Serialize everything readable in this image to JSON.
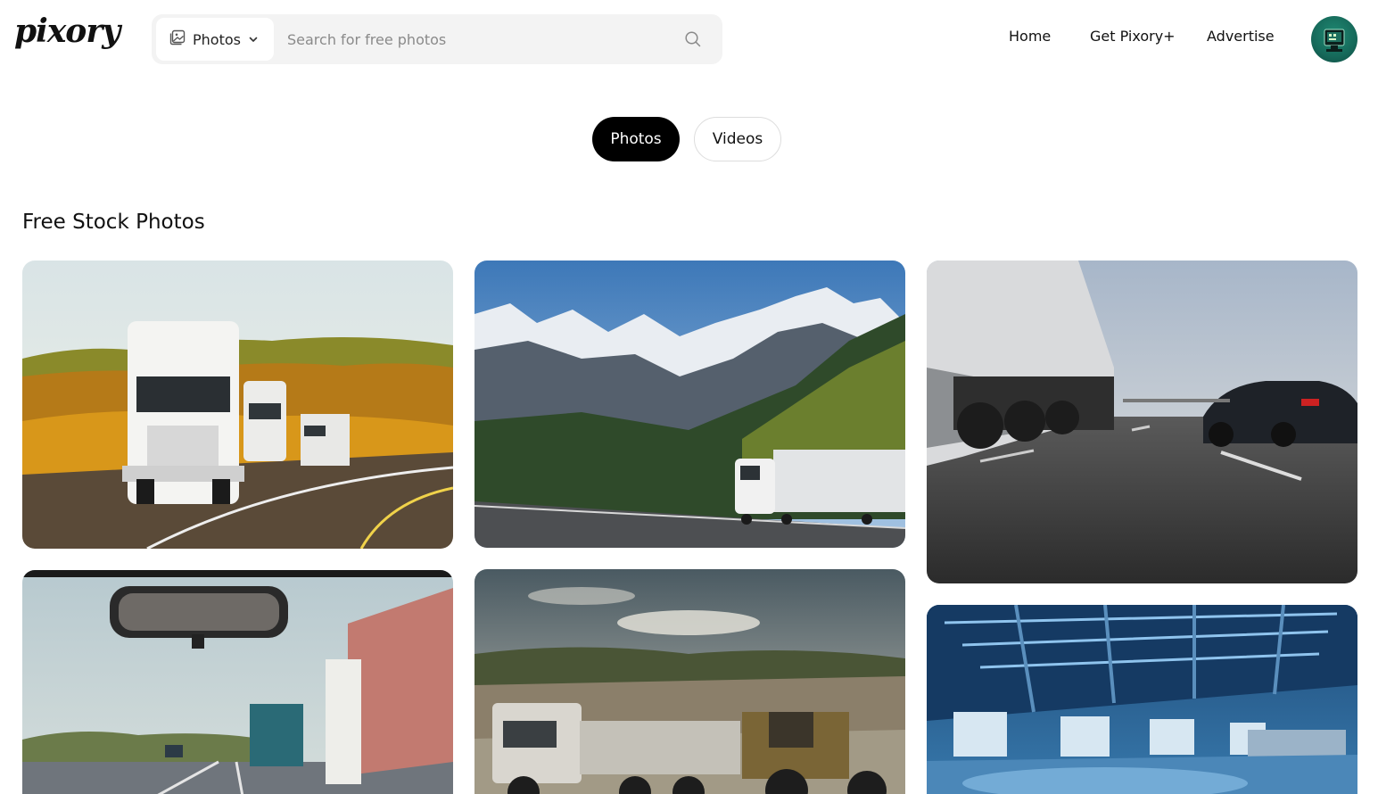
{
  "header": {
    "logo": "pixory",
    "search": {
      "type_label": "Photos",
      "placeholder": "Search for free photos"
    },
    "nav": {
      "home": "Home",
      "get_plus": "Get Pixory+",
      "advertise": "Advertise"
    }
  },
  "tabs": [
    {
      "label": "Photos",
      "active": true
    },
    {
      "label": "Videos",
      "active": false
    }
  ],
  "section_title": "Free Stock Photos",
  "icons": {
    "search_type": "image-icon",
    "dropdown": "chevron-down-icon",
    "search": "search-icon"
  },
  "colors": {
    "active_tab_bg": "#000000",
    "search_bg": "#f3f3f3",
    "avatar_bg": "#16695a"
  }
}
